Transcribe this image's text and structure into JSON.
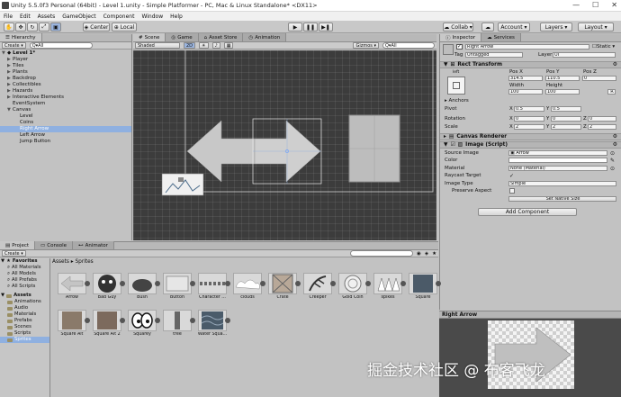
{
  "window": {
    "title": "Unity 5.5.0f3 Personal (64bit) - Level 1.unity - Simple Platformer - PC, Mac & Linux Standalone* <DX11>",
    "minimize": "—",
    "maximize": "☐",
    "close": "✕"
  },
  "menu": [
    "File",
    "Edit",
    "Assets",
    "GameObject",
    "Component",
    "Window",
    "Help"
  ],
  "toolbar": {
    "pivot_label": "Center",
    "space_label": "Local",
    "collab_label": "Collab ▾",
    "account_label": "Account ▾",
    "layers_label": "Layers ▾",
    "layout_label": "Layout ▾"
  },
  "hierarchy": {
    "tab": "Hierarchy",
    "create": "Create ▾",
    "search_placeholder": "Q▾All",
    "scene_name": "Level 1*",
    "items": [
      {
        "label": "Player",
        "indent": 1,
        "expand": true
      },
      {
        "label": "Tiles",
        "indent": 1,
        "expand": true
      },
      {
        "label": "Plants",
        "indent": 1,
        "expand": true
      },
      {
        "label": "Backdrop",
        "indent": 1,
        "expand": true
      },
      {
        "label": "Collectibles",
        "indent": 1,
        "expand": true
      },
      {
        "label": "Hazards",
        "indent": 1,
        "expand": true
      },
      {
        "label": "Interactive Elements",
        "indent": 1,
        "expand": true
      },
      {
        "label": "EventSystem",
        "indent": 1,
        "expand": false
      },
      {
        "label": "Canvas",
        "indent": 1,
        "expand": true,
        "open": true
      },
      {
        "label": "Level",
        "indent": 2,
        "expand": false
      },
      {
        "label": "Coins",
        "indent": 2,
        "expand": false
      },
      {
        "label": "Right Arrow",
        "indent": 2,
        "expand": false,
        "selected": true
      },
      {
        "label": "Left Arrow",
        "indent": 2,
        "expand": false
      },
      {
        "label": "Jump Button",
        "indent": 2,
        "expand": false
      }
    ]
  },
  "scene": {
    "tabs": [
      "Scene",
      "Game",
      "Asset Store",
      "Animation"
    ],
    "shading": "Shaded",
    "mode_2d": "2D",
    "gizmos": "Gizmos ▾",
    "search_placeholder": "Q▾All"
  },
  "inspector": {
    "tabs": [
      "Inspector",
      "Services"
    ],
    "object_name": "Right Arrow",
    "static_label": "Static ▾",
    "tag_label": "Tag",
    "tag_value": "Untagged",
    "layer_label": "Layer",
    "layer_value": "UI",
    "rect_transform": {
      "title": "Rect Transform",
      "anchor_label": "left",
      "pos_x_label": "Pos X",
      "pos_y_label": "Pos Y",
      "pos_z_label": "Pos Z",
      "pos_x": "314.5",
      "pos_y": "110.5",
      "pos_z": "0",
      "width_label": "Width",
      "height_label": "Height",
      "width": "100",
      "height": "100",
      "raw_button": "R",
      "anchors_label": "Anchors",
      "pivot_label": "Pivot",
      "pivot_x": "0.5",
      "pivot_y": "0.5",
      "rotation_label": "Rotation",
      "rot_x": "0",
      "rot_y": "0",
      "rot_z": "0",
      "scale_label": "Scale",
      "scale_x": "2",
      "scale_y": "2",
      "scale_z": "2",
      "x": "X",
      "y": "Y",
      "z": "Z"
    },
    "canvas_renderer": "Canvas Renderer",
    "image_script": {
      "title": "Image (Script)",
      "source_image_label": "Source Image",
      "source_image_value": "Arrow",
      "color_label": "Color",
      "material_label": "Material",
      "material_value": "None (Material)",
      "raycast_label": "Raycast Target",
      "image_type_label": "Image Type",
      "image_type_value": "Simple",
      "preserve_label": "Preserve Aspect",
      "native_size_button": "Set Native Size"
    },
    "add_component": "Add Component",
    "preview_title": "Right Arrow"
  },
  "project": {
    "tabs": [
      "Project",
      "Console",
      "Animator"
    ],
    "create": "Create ▾",
    "breadcrumb": "Assets ▸ Sprites",
    "favorites_label": "Favorites",
    "favorites": [
      "All Materials",
      "All Models",
      "All Prefabs",
      "All Scripts"
    ],
    "assets_label": "Assets",
    "folders": [
      "Animations",
      "Audio",
      "Materials",
      "Prefabs",
      "Scenes",
      "Scripts",
      "Sprites"
    ],
    "selected_folder": "Sprites",
    "assets_row1": [
      "Arrow",
      "Bad Guy",
      "Bush",
      "Button",
      "Character ...",
      "clouds",
      "Crate",
      "Creeper",
      "Gold Coin",
      "spikes",
      "Square"
    ],
    "assets_row2": [
      "Square Alt",
      "Square Alt 2",
      "Squarey",
      "tree",
      "Water Squa..."
    ]
  },
  "watermark": "掘金技术社区 @ 布客飞龙",
  "colors": {
    "selection": "#8fb0e0",
    "scene_bg": "#3c3c3c",
    "panel_bg": "#c2c2c2"
  }
}
